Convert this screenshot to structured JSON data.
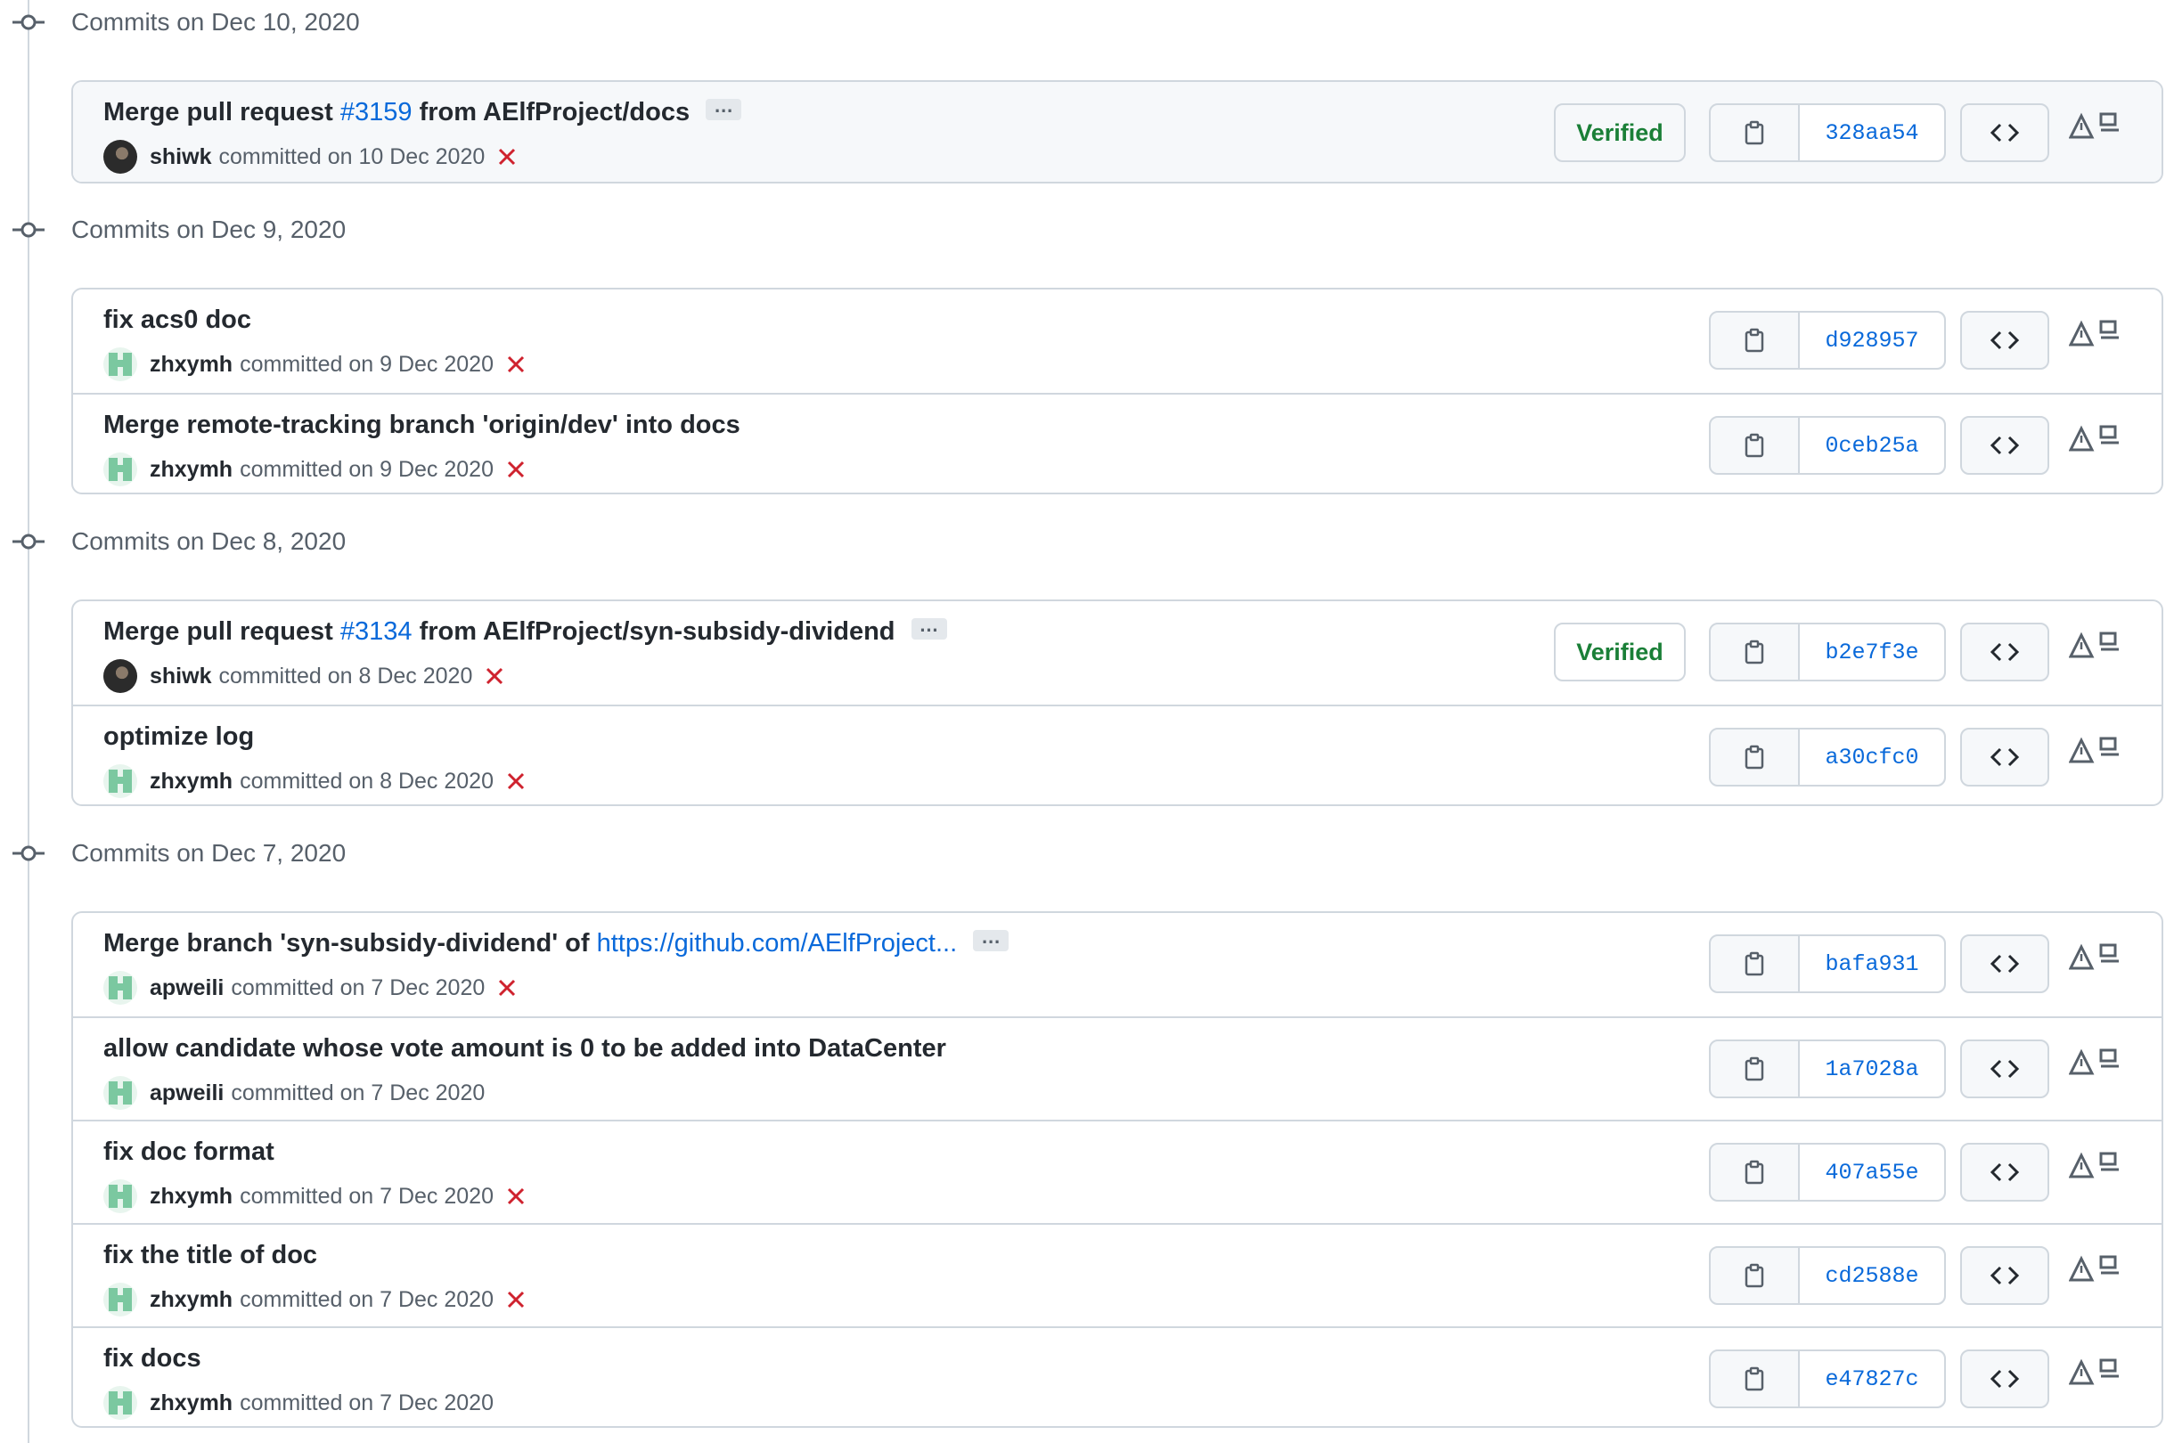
{
  "groups": [
    {
      "title": "Commits on Dec 10, 2020",
      "commits": [
        {
          "title_pre": "Merge pull request ",
          "link": "#3159",
          "title_post": " from AElfProject/docs",
          "has_ellipsis": true,
          "author": "shiwk",
          "committed": "committed on 10 Dec 2020",
          "status_icon": "x-icon",
          "avatar": "dark",
          "verified": "Verified",
          "sha": "328aa54",
          "highlight": true
        }
      ]
    },
    {
      "title": "Commits on Dec 9, 2020",
      "commits": [
        {
          "title_pre": "fix acs0 doc",
          "author": "zhxymh",
          "committed": "committed on 9 Dec 2020",
          "status_icon": "x-icon",
          "avatar": "green",
          "sha": "d928957"
        },
        {
          "title_pre": "Merge remote-tracking branch 'origin/dev' into docs",
          "author": "zhxymh",
          "committed": "committed on 9 Dec 2020",
          "status_icon": "x-icon",
          "avatar": "green",
          "sha": "0ceb25a"
        }
      ]
    },
    {
      "title": "Commits on Dec 8, 2020",
      "commits": [
        {
          "title_pre": "Merge pull request ",
          "link": "#3134",
          "title_post": " from AElfProject/syn-subsidy-dividend",
          "has_ellipsis": true,
          "author": "shiwk",
          "committed": "committed on 8 Dec 2020",
          "status_icon": "x-icon",
          "avatar": "dark",
          "verified": "Verified",
          "sha": "b2e7f3e"
        },
        {
          "title_pre": "optimize log",
          "author": "zhxymh",
          "committed": "committed on 8 Dec 2020",
          "status_icon": "x-icon",
          "avatar": "green",
          "sha": "a30cfc0"
        }
      ]
    },
    {
      "title": "Commits on Dec 7, 2020",
      "commits": [
        {
          "title_pre": "Merge branch 'syn-subsidy-dividend' of ",
          "link": "https://github.com/AElfProject...",
          "has_ellipsis": true,
          "author": "apweili",
          "committed": "committed on 7 Dec 2020",
          "status_icon": "x-icon",
          "avatar": "green",
          "sha": "bafa931"
        },
        {
          "title_pre": "allow candidate whose vote amount is 0 to be added into DataCenter",
          "author": "apweili",
          "committed": "committed on 7 Dec 2020",
          "avatar": "green",
          "sha": "1a7028a"
        },
        {
          "title_pre": "fix doc format",
          "author": "zhxymh",
          "committed": "committed on 7 Dec 2020",
          "status_icon": "x-icon",
          "avatar": "green",
          "sha": "407a55e"
        },
        {
          "title_pre": "fix the title of doc",
          "author": "zhxymh",
          "committed": "committed on 7 Dec 2020",
          "status_icon": "x-icon",
          "avatar": "green",
          "sha": "cd2588e"
        },
        {
          "title_pre": "fix docs",
          "author": "zhxymh",
          "committed": "committed on 7 Dec 2020",
          "avatar": "green",
          "sha": "e47827c"
        }
      ]
    }
  ],
  "ellipsis_label": "…",
  "colors": {
    "link": "#0969da",
    "verified": "#1a7f37",
    "fail": "#cf222e",
    "border": "#d0d7de"
  }
}
